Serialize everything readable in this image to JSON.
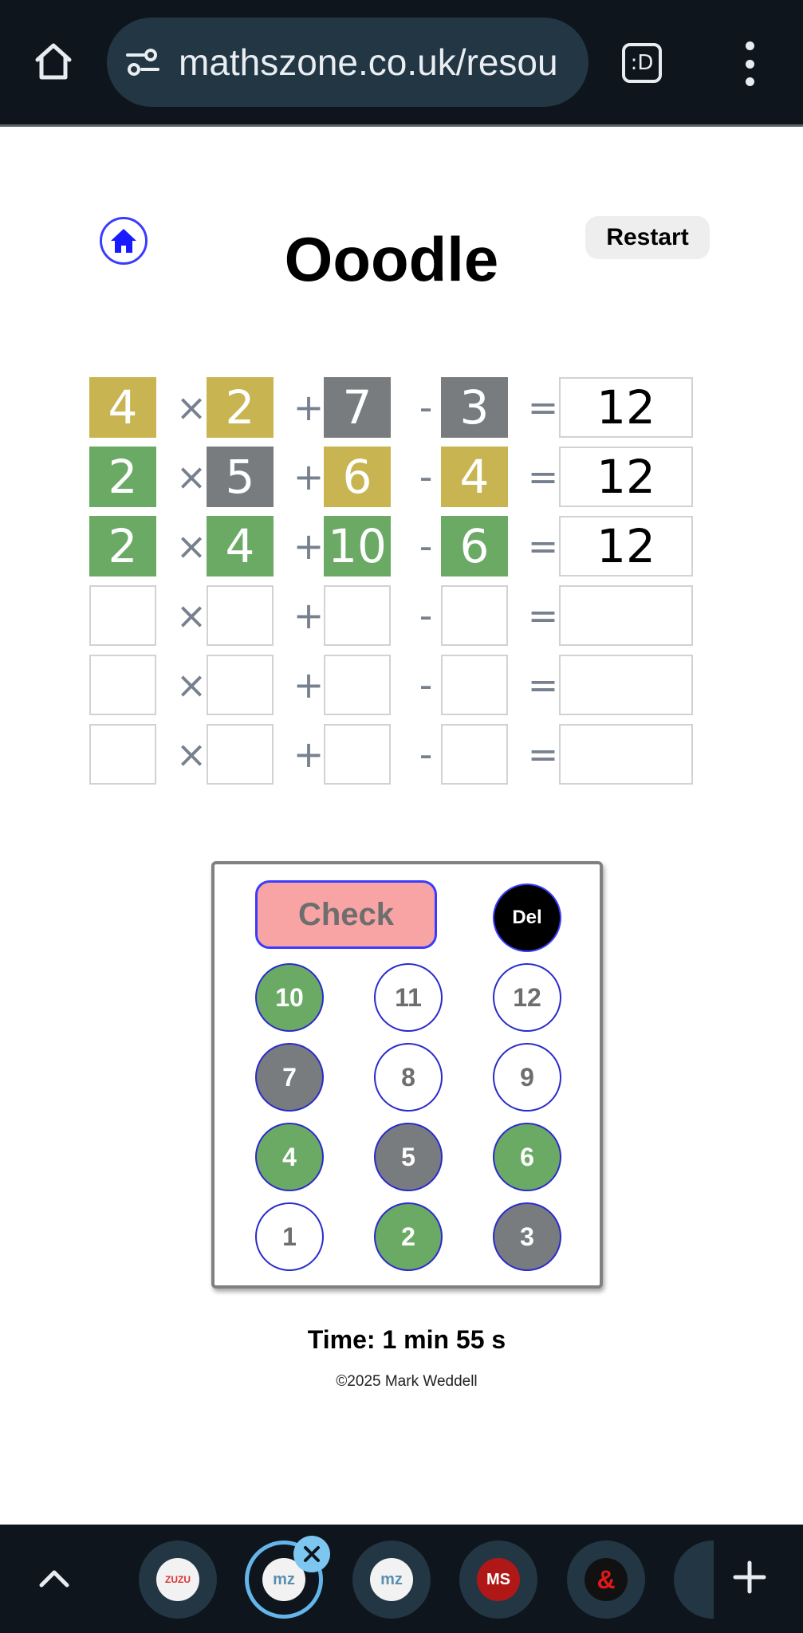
{
  "browser": {
    "url": "mathszone.co.uk/resou",
    "tabs_button_label": ":D"
  },
  "game": {
    "title": "Ooodle",
    "restart_label": "Restart",
    "operators": [
      "×",
      "+",
      "-",
      "="
    ],
    "rows": [
      {
        "cells": [
          {
            "value": "4",
            "state": "yellow"
          },
          {
            "value": "2",
            "state": "yellow"
          },
          {
            "value": "7",
            "state": "gray"
          },
          {
            "value": "3",
            "state": "gray"
          }
        ],
        "result": "12"
      },
      {
        "cells": [
          {
            "value": "2",
            "state": "green"
          },
          {
            "value": "5",
            "state": "gray"
          },
          {
            "value": "6",
            "state": "yellow"
          },
          {
            "value": "4",
            "state": "yellow"
          }
        ],
        "result": "12"
      },
      {
        "cells": [
          {
            "value": "2",
            "state": "green"
          },
          {
            "value": "4",
            "state": "green"
          },
          {
            "value": "10",
            "state": "green"
          },
          {
            "value": "6",
            "state": "green"
          }
        ],
        "result": "12"
      },
      {
        "cells": [
          {
            "value": "",
            "state": "empty"
          },
          {
            "value": "",
            "state": "empty"
          },
          {
            "value": "",
            "state": "empty"
          },
          {
            "value": "",
            "state": "empty"
          }
        ],
        "result": ""
      },
      {
        "cells": [
          {
            "value": "",
            "state": "empty"
          },
          {
            "value": "",
            "state": "empty"
          },
          {
            "value": "",
            "state": "empty"
          },
          {
            "value": "",
            "state": "empty"
          }
        ],
        "result": ""
      },
      {
        "cells": [
          {
            "value": "",
            "state": "empty"
          },
          {
            "value": "",
            "state": "empty"
          },
          {
            "value": "",
            "state": "empty"
          },
          {
            "value": "",
            "state": "empty"
          }
        ],
        "result": ""
      }
    ]
  },
  "keypad": {
    "check_label": "Check",
    "del_label": "Del",
    "keys": [
      {
        "label": "10",
        "state": "green"
      },
      {
        "label": "11",
        "state": "unused"
      },
      {
        "label": "12",
        "state": "unused"
      },
      {
        "label": "7",
        "state": "gray"
      },
      {
        "label": "8",
        "state": "unused"
      },
      {
        "label": "9",
        "state": "unused"
      },
      {
        "label": "4",
        "state": "green"
      },
      {
        "label": "5",
        "state": "gray"
      },
      {
        "label": "6",
        "state": "green"
      },
      {
        "label": "1",
        "state": "unused"
      },
      {
        "label": "2",
        "state": "green"
      },
      {
        "label": "3",
        "state": "gray"
      }
    ]
  },
  "footer": {
    "timer": "Time: 1 min 55 s",
    "copyright": "©2025 Mark Weddell"
  },
  "tab_strip": {
    "tabs": [
      {
        "label": "ZUZU",
        "icon": "zuzu-tab-icon"
      },
      {
        "label": "mz",
        "icon": "mathszone-tab-icon"
      },
      {
        "label": "mz",
        "icon": "mathszone-tab-icon"
      },
      {
        "label": "MS",
        "icon": "ms-tab-icon"
      },
      {
        "label": "&",
        "icon": "dnd-tab-icon"
      }
    ]
  },
  "colors": {
    "yellow": "#c8b552",
    "green": "#6aaa64",
    "gray": "#787c7e",
    "check_bg": "#f8a4a4",
    "accent": "#3b3bff"
  }
}
